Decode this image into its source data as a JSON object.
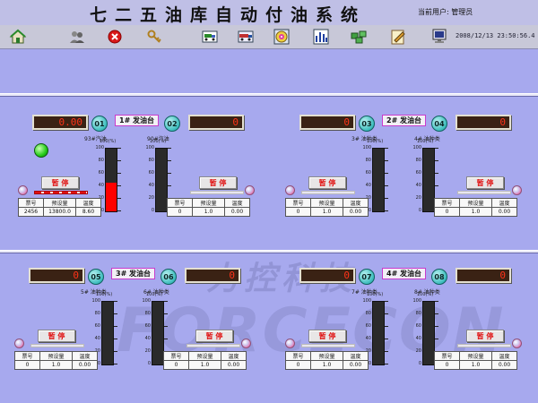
{
  "header": {
    "title": "七二五油库自动付油系统",
    "user_label": "当前用户: 管理员"
  },
  "toolbar": {
    "items": [
      "home-icon",
      "users-icon",
      "close-icon",
      "keys-icon",
      "truck-list-icon",
      "truck-icon",
      "disk-icon",
      "bar-chart-icon",
      "network-icon",
      "edit-icon",
      "computer-icon"
    ]
  },
  "datetime": "2008/12/13 23:50:56.4",
  "platforms": [
    {
      "label": "1# 发油台"
    },
    {
      "label": "2# 发油台"
    },
    {
      "label": "3# 发油台"
    },
    {
      "label": "4# 发油台"
    }
  ],
  "gauge_scale": {
    "unit": "100(%)",
    "ticks": [
      "100",
      "80",
      "60",
      "40",
      "20",
      "0"
    ]
  },
  "table_headers": {
    "ticket": "票号",
    "preset": "预设量",
    "temp": "温度"
  },
  "pause_label": "暂 停",
  "watermark": {
    "cn": "力控科技",
    "en": "FORCECON"
  },
  "lanes": [
    {
      "num": "01",
      "display": "0.00",
      "product": "93#汽油",
      "level": 0.45,
      "ticket": "2456",
      "preset": "13800.0",
      "temp": "8.60",
      "status": "active"
    },
    {
      "num": "02",
      "display": "0",
      "product": "90#汽油",
      "level": 0,
      "ticket": "0",
      "preset": "1.0",
      "temp": "0.00",
      "status": "idle"
    },
    {
      "num": "03",
      "display": "0",
      "product": "3# 油种类",
      "level": 0,
      "ticket": "0",
      "preset": "1.0",
      "temp": "0.00",
      "status": "idle"
    },
    {
      "num": "04",
      "display": "0",
      "product": "4# 油种类",
      "level": 0,
      "ticket": "0",
      "preset": "1.0",
      "temp": "0.00",
      "status": "idle"
    },
    {
      "num": "05",
      "display": "0",
      "product": "5# 油种类",
      "level": 0,
      "ticket": "0",
      "preset": "1.0",
      "temp": "0.00",
      "status": "idle"
    },
    {
      "num": "06",
      "display": "0",
      "product": "6# 油种类",
      "level": 0,
      "ticket": "0",
      "preset": "1.0",
      "temp": "0.00",
      "status": "idle"
    },
    {
      "num": "07",
      "display": "0",
      "product": "7# 油种类",
      "level": 0,
      "ticket": "0",
      "preset": "1.0",
      "temp": "0.00",
      "status": "idle"
    },
    {
      "num": "08",
      "display": "0",
      "product": "8# 油种类",
      "level": 0,
      "ticket": "0",
      "preset": "1.0",
      "temp": "0.00",
      "status": "idle"
    }
  ],
  "colors": {
    "background": "#a7a9ee",
    "display_digits": "#ff3218",
    "active_led": "#24cc18",
    "badge": "#3cbcbc",
    "level_fill": "#ff0000"
  }
}
